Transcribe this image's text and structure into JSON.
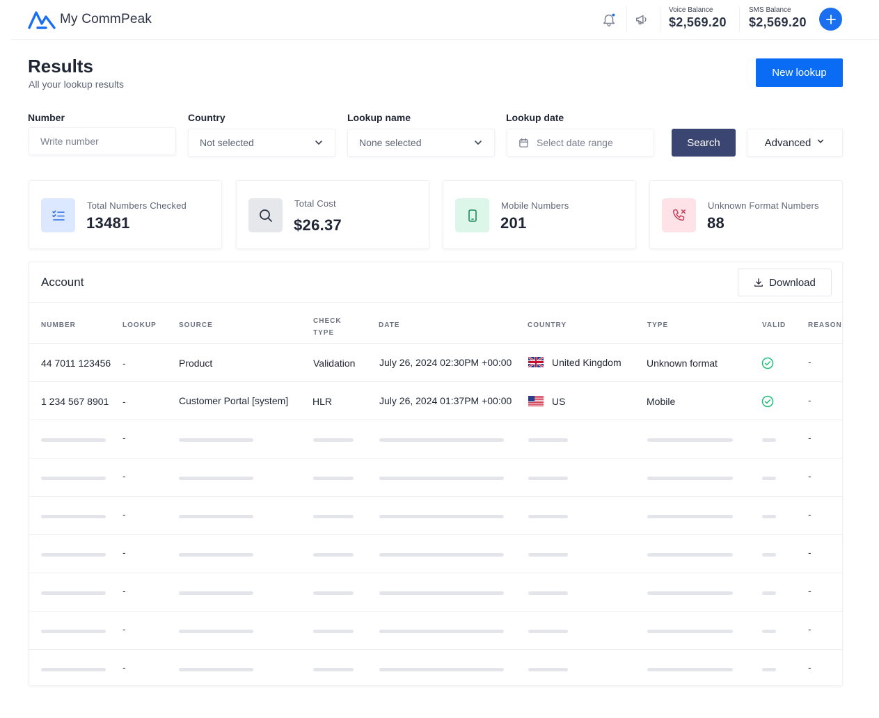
{
  "app": {
    "name": "My CommPeak",
    "logo_icon": "commpeak-logo-icon"
  },
  "topbar": {
    "voice_balance_label": "Voice Balance",
    "voice_balance_value": "$2,569.20",
    "sms_balance_label": "SMS Balance",
    "sms_balance_value": "$2,569.20",
    "icons": [
      "bell-icon",
      "megaphone-icon",
      "plus-icon"
    ],
    "accent_color": "#1a6ff0"
  },
  "header": {
    "title": "Results",
    "subtitle": "All your lookup results",
    "new_lookup_label": "New lookup"
  },
  "filters": {
    "number_label": "Number",
    "number_placeholder": "Write number",
    "country_label": "Country",
    "country_value": "Not selected",
    "lookup_name_label": "Lookup name",
    "lookup_name_value": "None selected",
    "lookup_date_label": "Lookup date",
    "lookup_date_placeholder": "Select date range",
    "search_label": "Search",
    "advanced_label": "Advanced"
  },
  "stats": [
    {
      "label": "Total Numbers Checked",
      "value": "13481",
      "icon": "checklist-icon",
      "icon_bg": "#dbe8ff"
    },
    {
      "label": "Total Cost",
      "value": "$26.37",
      "icon": "search-icon",
      "icon_bg": "#e6e7ea"
    },
    {
      "label": "Mobile Numbers",
      "value": "201",
      "icon": "mobile-phone-icon",
      "icon_bg": "#dcf6ea"
    },
    {
      "label": "Unknown Format Numbers",
      "value": "88",
      "icon": "phone-missed-icon",
      "icon_bg": "#fde3e8"
    }
  ],
  "table": {
    "title": "Account",
    "download_label": "Download",
    "columns": {
      "number": "NUMBER",
      "lookup": "LOOKUP",
      "source": "SOURCE",
      "check_type_1": "CHECK",
      "check_type_2": "TYPE",
      "date": "DATE",
      "country": "COUNTRY",
      "type": "TYPE",
      "valid": "VALID",
      "reason": "REASON"
    },
    "rows": [
      {
        "number": "44 7011 123456",
        "lookup": "-",
        "source": "Product",
        "check_type": "Validation",
        "date": "July 26, 2024 02:30PM +00:00",
        "country": "United Kingdom",
        "flag": "uk-flag-icon",
        "type": "Unknown format",
        "valid": "check-circle-icon",
        "reason": "-"
      },
      {
        "number": "1 234 567 8901",
        "lookup": "-",
        "source": "Customer Portal [system]",
        "check_type": "HLR",
        "date": "July 26, 2024 01:37PM +00:00",
        "country": "US",
        "flag": "us-flag-icon",
        "type": "Mobile",
        "valid": "check-circle-icon",
        "reason": "-"
      }
    ],
    "placeholder_rows": [
      {
        "lookup": "-",
        "reason": "-"
      },
      {
        "lookup": "-",
        "reason": "-"
      },
      {
        "lookup": "-",
        "reason": "-"
      },
      {
        "lookup": "-",
        "reason": "-"
      },
      {
        "lookup": "-",
        "reason": "-"
      },
      {
        "lookup": "-",
        "reason": "-"
      },
      {
        "lookup": "-",
        "reason": "-"
      }
    ],
    "valid_color": "#1fbf7a"
  }
}
